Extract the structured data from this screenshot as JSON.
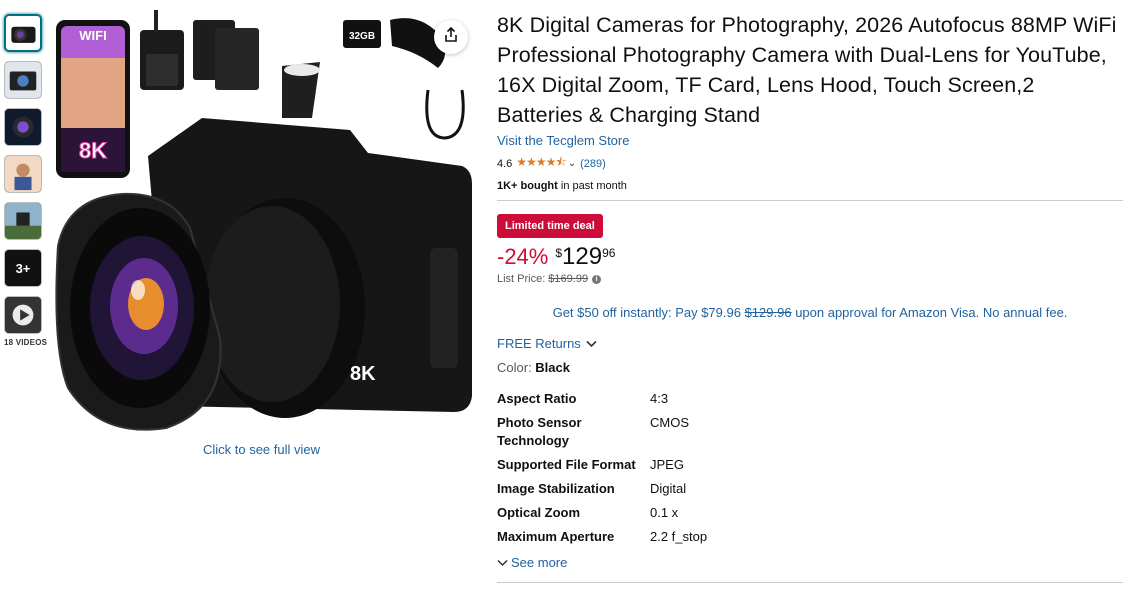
{
  "gallery": {
    "thumbnails": [
      "camera-front",
      "camera-accessories",
      "camera-lens",
      "camera-portrait",
      "camera-outdoor"
    ],
    "more_label": "3+",
    "video_label": "18 VIDEOS",
    "main_image_badges": {
      "wifi": "WIFI",
      "resolution": "8K",
      "sd_card": "32GB",
      "camera_brand_8k": "8K"
    },
    "full_view_label": "Click to see full view"
  },
  "product": {
    "title": "8K Digital Cameras for Photography, 2026 Autofocus 88MP WiFi Professional Photography Camera with Dual-Lens for YouTube, 16X Digital Zoom, TF Card, Lens Hood, Touch Screen,2 Batteries & Charging Stand",
    "store_link": "Visit the Tecglem Store",
    "rating": "4.6",
    "stars": "★★★★⯪",
    "rating_count": "(289)",
    "bought_bold": "1K+ bought",
    "bought_rest": " in past month"
  },
  "pricing": {
    "deal_badge": "Limited time deal",
    "discount": "-24%",
    "currency": "$",
    "whole": "129",
    "fraction": "96",
    "list_price_label": "List Price:",
    "list_price": "$169.99",
    "promo_prefix": "Get $50 off instantly: Pay $79.96 ",
    "promo_strike": "$129.96",
    "promo_suffix": " upon approval for Amazon Visa. No annual fee."
  },
  "returns_label": "FREE Returns",
  "color": {
    "label": "Color: ",
    "value": "Black"
  },
  "specs": [
    {
      "key": "Aspect Ratio",
      "value": "4:3"
    },
    {
      "key": "Photo Sensor Technology",
      "value": "CMOS"
    },
    {
      "key": "Supported File Format",
      "value": "JPEG"
    },
    {
      "key": "Image Stabilization",
      "value": "Digital"
    },
    {
      "key": "Optical Zoom",
      "value": "0.1 x"
    },
    {
      "key": "Maximum Aperture",
      "value": "2.2 f_stop"
    }
  ],
  "see_more_label": "See more",
  "colors": {
    "link": "#2162a1",
    "deal": "#cc0c39",
    "star": "#de7921"
  }
}
